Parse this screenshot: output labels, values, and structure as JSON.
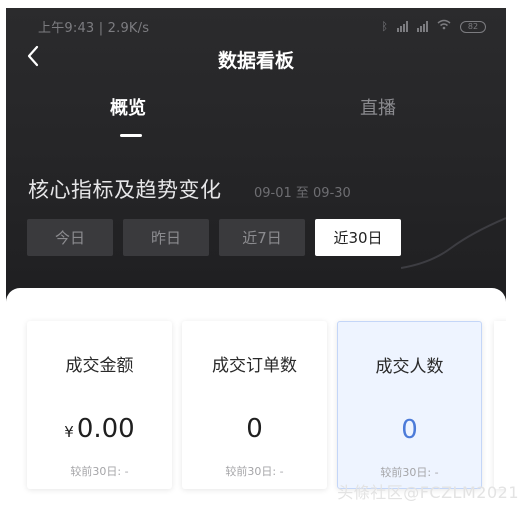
{
  "status_bar": {
    "time_text": "上午9:43 | 2.9K/s",
    "battery": "82"
  },
  "nav": {
    "title": "数据看板",
    "back_icon": "chevron-left-icon"
  },
  "tabs": [
    {
      "label": "概览",
      "active": true
    },
    {
      "label": "直播",
      "active": false
    }
  ],
  "section": {
    "title": "核心指标及趋势变化",
    "date_range": "09-01 至 09-30"
  },
  "range_buttons": [
    {
      "label": "今日",
      "selected": false
    },
    {
      "label": "昨日",
      "selected": false
    },
    {
      "label": "近7日",
      "selected": false
    },
    {
      "label": "近30日",
      "selected": true
    }
  ],
  "metrics": [
    {
      "label": "成交金额",
      "currency": "¥",
      "value": "0.00",
      "compare": "较前30日: -",
      "active": false
    },
    {
      "label": "成交订单数",
      "currency": "",
      "value": "0",
      "compare": "较前30日: -",
      "active": false
    },
    {
      "label": "成交人数",
      "currency": "",
      "value": "0",
      "compare": "较前30日: -",
      "active": true
    }
  ],
  "watermark": "头條社区@FCZLM2021",
  "colors": {
    "header_bg": "#262628",
    "accent_blue": "#4c7bd9",
    "active_card_bg": "#eef4ff"
  }
}
